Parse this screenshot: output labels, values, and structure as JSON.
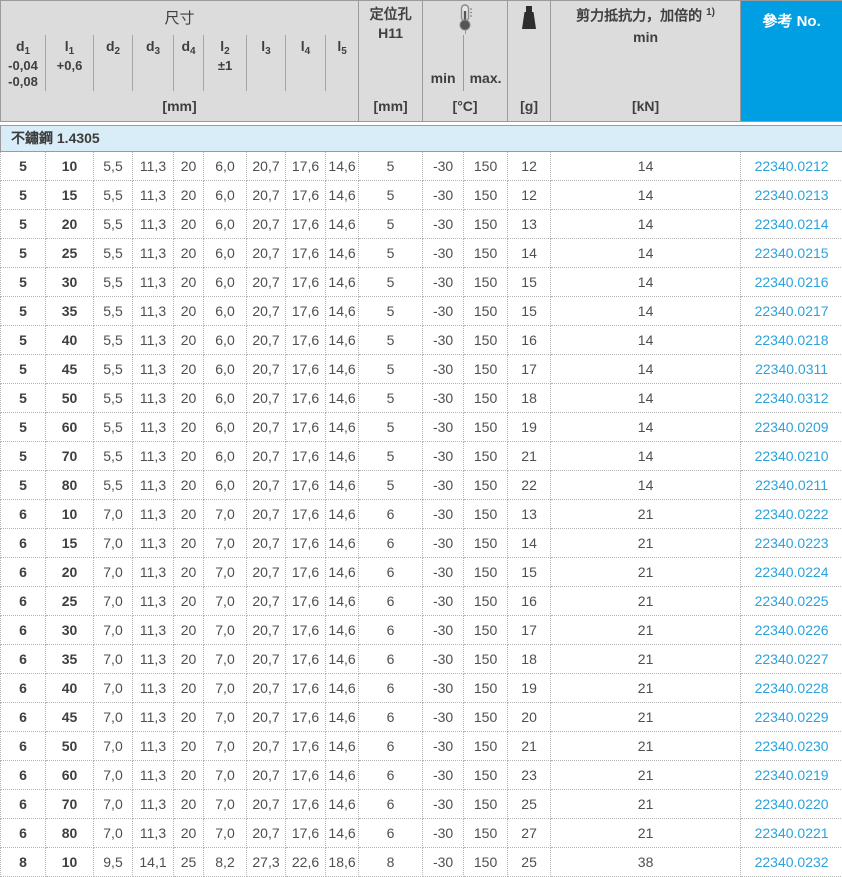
{
  "header": {
    "dims_title": "尺寸",
    "dim_cols": [
      {
        "base": "d",
        "sub": "1",
        "tol1": "-0,04",
        "tol2": "-0,08"
      },
      {
        "base": "l",
        "sub": "1",
        "tol1": "+0,6"
      },
      {
        "base": "d",
        "sub": "2"
      },
      {
        "base": "d",
        "sub": "3"
      },
      {
        "base": "d",
        "sub": "4"
      },
      {
        "base": "l",
        "sub": "2",
        "tol1": "±1"
      },
      {
        "base": "l",
        "sub": "3"
      },
      {
        "base": "l",
        "sub": "4"
      },
      {
        "base": "l",
        "sub": "5"
      }
    ],
    "dims_unit": "[mm]",
    "h11": {
      "line1": "定位孔",
      "line2": "H11",
      "unit": "[mm]"
    },
    "temp": {
      "icon": "thermometer-icon",
      "min": "min",
      "max": "max.",
      "unit": "[°C]"
    },
    "weight": {
      "icon": "weight-icon",
      "unit": "[g]"
    },
    "shear": {
      "title": "剪力抵抗力，加倍的",
      "sup": "1)",
      "min": "min",
      "unit": "[kN]"
    },
    "ref_title": "參考 No."
  },
  "section": {
    "label": "不鏽鋼 1.4305"
  },
  "colors": {
    "brand_blue": "#009ee3",
    "link_blue": "#2ba3dd",
    "section_bg": "#d9edf8",
    "header_bg": "#dcdcdc"
  },
  "rows": [
    [
      "5",
      "10",
      "5,5",
      "11,3",
      "20",
      "6,0",
      "20,7",
      "17,6",
      "14,6",
      "5",
      "-30",
      "150",
      "12",
      "14",
      "22340.0212"
    ],
    [
      "5",
      "15",
      "5,5",
      "11,3",
      "20",
      "6,0",
      "20,7",
      "17,6",
      "14,6",
      "5",
      "-30",
      "150",
      "12",
      "14",
      "22340.0213"
    ],
    [
      "5",
      "20",
      "5,5",
      "11,3",
      "20",
      "6,0",
      "20,7",
      "17,6",
      "14,6",
      "5",
      "-30",
      "150",
      "13",
      "14",
      "22340.0214"
    ],
    [
      "5",
      "25",
      "5,5",
      "11,3",
      "20",
      "6,0",
      "20,7",
      "17,6",
      "14,6",
      "5",
      "-30",
      "150",
      "14",
      "14",
      "22340.0215"
    ],
    [
      "5",
      "30",
      "5,5",
      "11,3",
      "20",
      "6,0",
      "20,7",
      "17,6",
      "14,6",
      "5",
      "-30",
      "150",
      "15",
      "14",
      "22340.0216"
    ],
    [
      "5",
      "35",
      "5,5",
      "11,3",
      "20",
      "6,0",
      "20,7",
      "17,6",
      "14,6",
      "5",
      "-30",
      "150",
      "15",
      "14",
      "22340.0217"
    ],
    [
      "5",
      "40",
      "5,5",
      "11,3",
      "20",
      "6,0",
      "20,7",
      "17,6",
      "14,6",
      "5",
      "-30",
      "150",
      "16",
      "14",
      "22340.0218"
    ],
    [
      "5",
      "45",
      "5,5",
      "11,3",
      "20",
      "6,0",
      "20,7",
      "17,6",
      "14,6",
      "5",
      "-30",
      "150",
      "17",
      "14",
      "22340.0311"
    ],
    [
      "5",
      "50",
      "5,5",
      "11,3",
      "20",
      "6,0",
      "20,7",
      "17,6",
      "14,6",
      "5",
      "-30",
      "150",
      "18",
      "14",
      "22340.0312"
    ],
    [
      "5",
      "60",
      "5,5",
      "11,3",
      "20",
      "6,0",
      "20,7",
      "17,6",
      "14,6",
      "5",
      "-30",
      "150",
      "19",
      "14",
      "22340.0209"
    ],
    [
      "5",
      "70",
      "5,5",
      "11,3",
      "20",
      "6,0",
      "20,7",
      "17,6",
      "14,6",
      "5",
      "-30",
      "150",
      "21",
      "14",
      "22340.0210"
    ],
    [
      "5",
      "80",
      "5,5",
      "11,3",
      "20",
      "6,0",
      "20,7",
      "17,6",
      "14,6",
      "5",
      "-30",
      "150",
      "22",
      "14",
      "22340.0211"
    ],
    [
      "6",
      "10",
      "7,0",
      "11,3",
      "20",
      "7,0",
      "20,7",
      "17,6",
      "14,6",
      "6",
      "-30",
      "150",
      "13",
      "21",
      "22340.0222"
    ],
    [
      "6",
      "15",
      "7,0",
      "11,3",
      "20",
      "7,0",
      "20,7",
      "17,6",
      "14,6",
      "6",
      "-30",
      "150",
      "14",
      "21",
      "22340.0223"
    ],
    [
      "6",
      "20",
      "7,0",
      "11,3",
      "20",
      "7,0",
      "20,7",
      "17,6",
      "14,6",
      "6",
      "-30",
      "150",
      "15",
      "21",
      "22340.0224"
    ],
    [
      "6",
      "25",
      "7,0",
      "11,3",
      "20",
      "7,0",
      "20,7",
      "17,6",
      "14,6",
      "6",
      "-30",
      "150",
      "16",
      "21",
      "22340.0225"
    ],
    [
      "6",
      "30",
      "7,0",
      "11,3",
      "20",
      "7,0",
      "20,7",
      "17,6",
      "14,6",
      "6",
      "-30",
      "150",
      "17",
      "21",
      "22340.0226"
    ],
    [
      "6",
      "35",
      "7,0",
      "11,3",
      "20",
      "7,0",
      "20,7",
      "17,6",
      "14,6",
      "6",
      "-30",
      "150",
      "18",
      "21",
      "22340.0227"
    ],
    [
      "6",
      "40",
      "7,0",
      "11,3",
      "20",
      "7,0",
      "20,7",
      "17,6",
      "14,6",
      "6",
      "-30",
      "150",
      "19",
      "21",
      "22340.0228"
    ],
    [
      "6",
      "45",
      "7,0",
      "11,3",
      "20",
      "7,0",
      "20,7",
      "17,6",
      "14,6",
      "6",
      "-30",
      "150",
      "20",
      "21",
      "22340.0229"
    ],
    [
      "6",
      "50",
      "7,0",
      "11,3",
      "20",
      "7,0",
      "20,7",
      "17,6",
      "14,6",
      "6",
      "-30",
      "150",
      "21",
      "21",
      "22340.0230"
    ],
    [
      "6",
      "60",
      "7,0",
      "11,3",
      "20",
      "7,0",
      "20,7",
      "17,6",
      "14,6",
      "6",
      "-30",
      "150",
      "23",
      "21",
      "22340.0219"
    ],
    [
      "6",
      "70",
      "7,0",
      "11,3",
      "20",
      "7,0",
      "20,7",
      "17,6",
      "14,6",
      "6",
      "-30",
      "150",
      "25",
      "21",
      "22340.0220"
    ],
    [
      "6",
      "80",
      "7,0",
      "11,3",
      "20",
      "7,0",
      "20,7",
      "17,6",
      "14,6",
      "6",
      "-30",
      "150",
      "27",
      "21",
      "22340.0221"
    ],
    [
      "8",
      "10",
      "9,5",
      "14,1",
      "25",
      "8,2",
      "27,3",
      "22,6",
      "18,6",
      "8",
      "-30",
      "150",
      "25",
      "38",
      "22340.0232"
    ]
  ]
}
